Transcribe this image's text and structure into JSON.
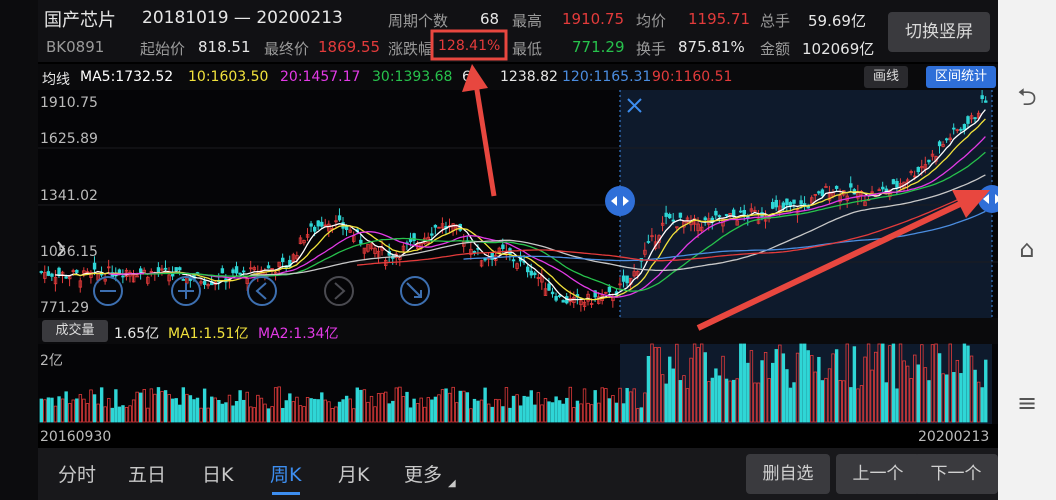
{
  "header": {
    "name": "国产芯片",
    "range": "20181019 — 20200213",
    "code": "BK0891",
    "switch_button": "切换竖屏",
    "stats": {
      "period_label": "周期个数",
      "period_value": "68",
      "high_label": "最高",
      "high_value": "1910.75",
      "avg_label": "均价",
      "avg_value": "1195.71",
      "total_label": "总手",
      "total_value": "59.69亿",
      "start_label": "起始价",
      "start_value": "818.51",
      "end_label": "最终价",
      "end_value": "1869.55",
      "change_label": "涨跌幅",
      "change_value": "128.41%",
      "low_label": "最低",
      "low_value": "771.29",
      "turnover_label": "换手",
      "turnover_value": "875.81%",
      "amount_label": "金额",
      "amount_value": "102069亿"
    }
  },
  "ma_row": {
    "title": "均线",
    "ma5": "MA5:1732.52",
    "ma10": "10:1603.50",
    "ma20": "20:1457.17",
    "ma30": "30:1393.68",
    "ma60": "6",
    "ma60_rest": "1238.82",
    "ma120": "120:1165.31",
    "ma90": "90:1160.51",
    "draw_button": "画线",
    "interval_button": "区间统计"
  },
  "price_axis": [
    "1910.75",
    "1625.89",
    "1341.02",
    "1056.15",
    "771.29"
  ],
  "volume_row": {
    "button": "成交量",
    "value": "1.65亿",
    "ma1": "MA1:1.51亿",
    "ma2": "MA2:1.34亿",
    "axis_label": "2亿"
  },
  "date_start": "20160930",
  "date_end": "20200213",
  "tabs": [
    "分时",
    "五日",
    "日K",
    "周K",
    "月K",
    "更多"
  ],
  "bottom_buttons": {
    "remove": "删自选",
    "prev": "上一个",
    "next": "下一个"
  },
  "colors": {
    "up": "#e33b3b",
    "down": "#2fd6d6",
    "ma5": "#ffffff",
    "ma10": "#f1e23c",
    "ma20": "#e23ae6",
    "ma30": "#27c24c",
    "ma120": "#4b8de0",
    "ma90": "#e33b3b",
    "accent": "#3d8ef0",
    "annotation": "#e8473f"
  },
  "icons": [
    "zoom-out-icon",
    "zoom-in-icon",
    "move-left-icon",
    "move-right-icon",
    "collapse-icon",
    "close-icon",
    "drag-handle-icon",
    "back-icon",
    "home-icon",
    "menu-icon"
  ]
}
